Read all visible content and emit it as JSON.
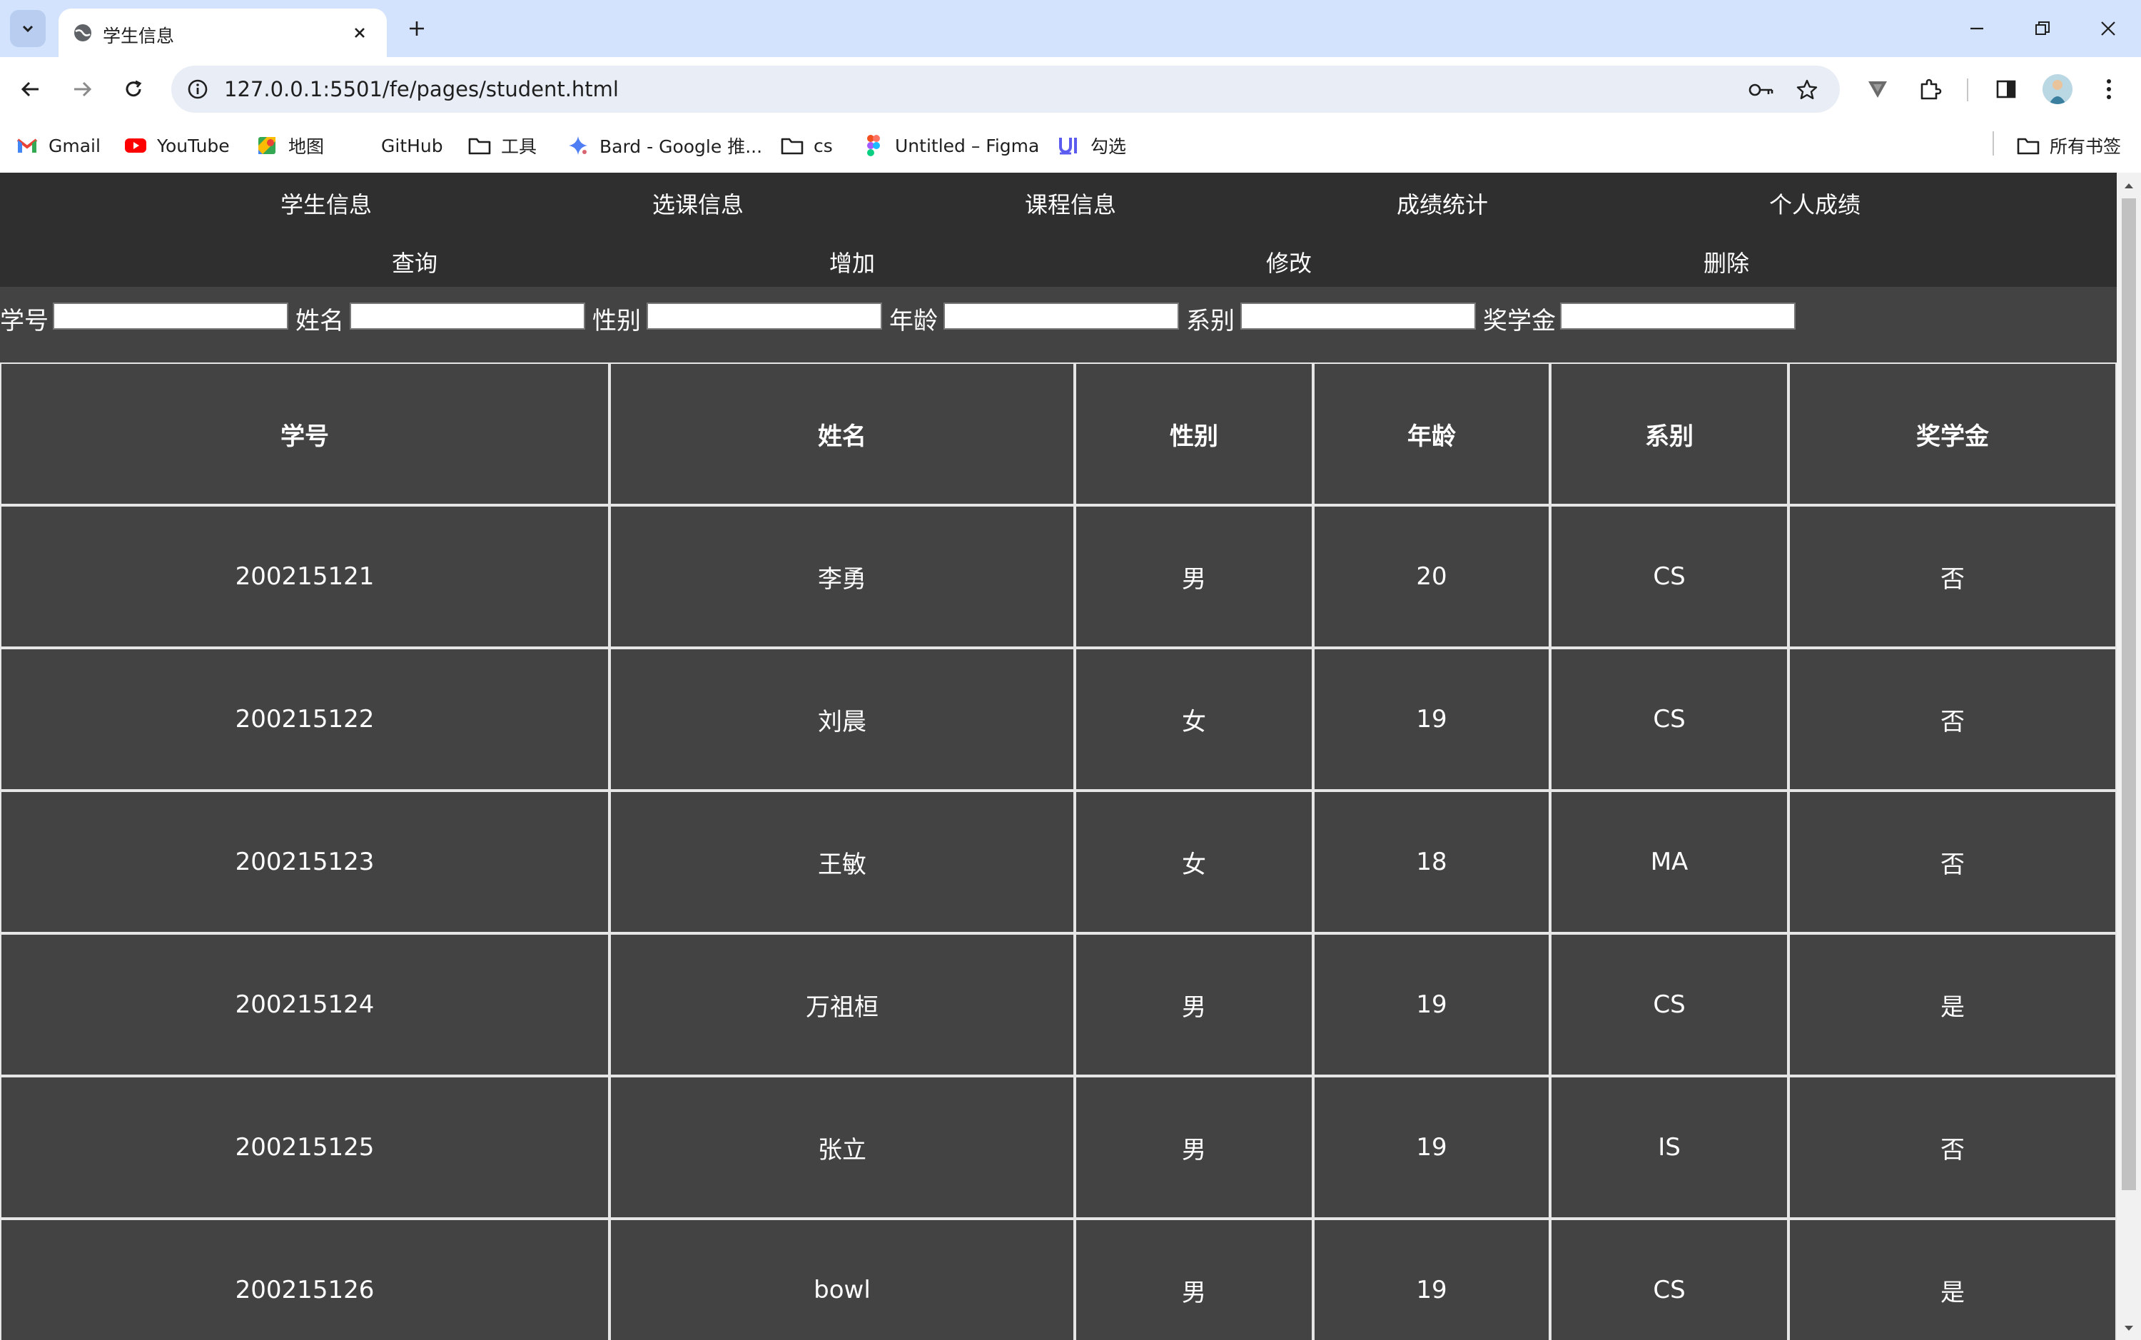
{
  "browser": {
    "tab_title": "学生信息",
    "url": "127.0.0.1:5501/fe/pages/student.html",
    "bookmarks": [
      "Gmail",
      "YouTube",
      "地图",
      "GitHub",
      "工具",
      "Bard - Google 推...",
      "cs",
      "Untitled – Figma",
      "勾选"
    ],
    "all_bookmarks": "所有书签"
  },
  "nav": {
    "primary": [
      "学生信息",
      "选课信息",
      "课程信息",
      "成绩统计",
      "个人成绩"
    ],
    "actions": [
      "查询",
      "增加",
      "修改",
      "删除"
    ]
  },
  "filters": [
    {
      "label": "学号",
      "value": ""
    },
    {
      "label": "姓名",
      "value": ""
    },
    {
      "label": "性别",
      "value": ""
    },
    {
      "label": "年龄",
      "value": ""
    },
    {
      "label": "系别",
      "value": ""
    },
    {
      "label": "奖学金",
      "value": ""
    }
  ],
  "table": {
    "headers": [
      "学号",
      "姓名",
      "性别",
      "年龄",
      "系别",
      "奖学金"
    ],
    "rows": [
      [
        "200215121",
        "李勇",
        "男",
        "20",
        "CS",
        "否"
      ],
      [
        "200215122",
        "刘晨",
        "女",
        "19",
        "CS",
        "否"
      ],
      [
        "200215123",
        "王敏",
        "女",
        "18",
        "MA",
        "否"
      ],
      [
        "200215124",
        "万祖桓",
        "男",
        "19",
        "CS",
        "是"
      ],
      [
        "200215125",
        "张立",
        "男",
        "19",
        "IS",
        "否"
      ],
      [
        "200215126",
        "bowl",
        "男",
        "19",
        "CS",
        "是"
      ]
    ]
  },
  "colors": {
    "page_bg": "#434343",
    "nav_bg": "#2f2f2f",
    "tabstrip_bg": "#d3e3fd"
  }
}
